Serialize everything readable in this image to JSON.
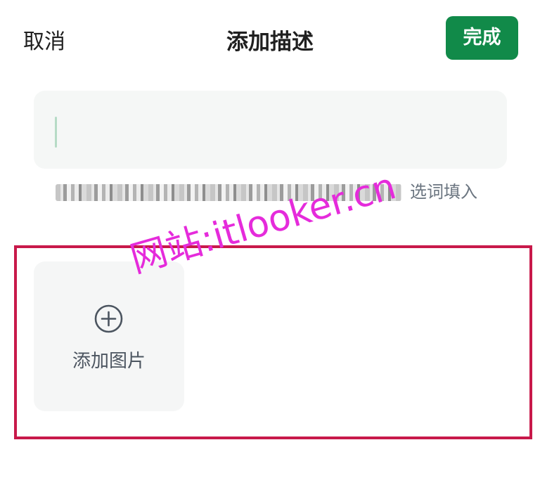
{
  "header": {
    "cancel_label": "取消",
    "title": "添加描述",
    "done_label": "完成"
  },
  "description": {
    "value": "",
    "hint_suffix": "选词填入"
  },
  "image_picker": {
    "add_label": "添加图片",
    "icon": "plus-circle-icon"
  },
  "watermark": "网站:itlooker.cn",
  "colors": {
    "accent": "#118a49",
    "highlight_border": "#c8194a",
    "watermark": "#e52bdb"
  }
}
